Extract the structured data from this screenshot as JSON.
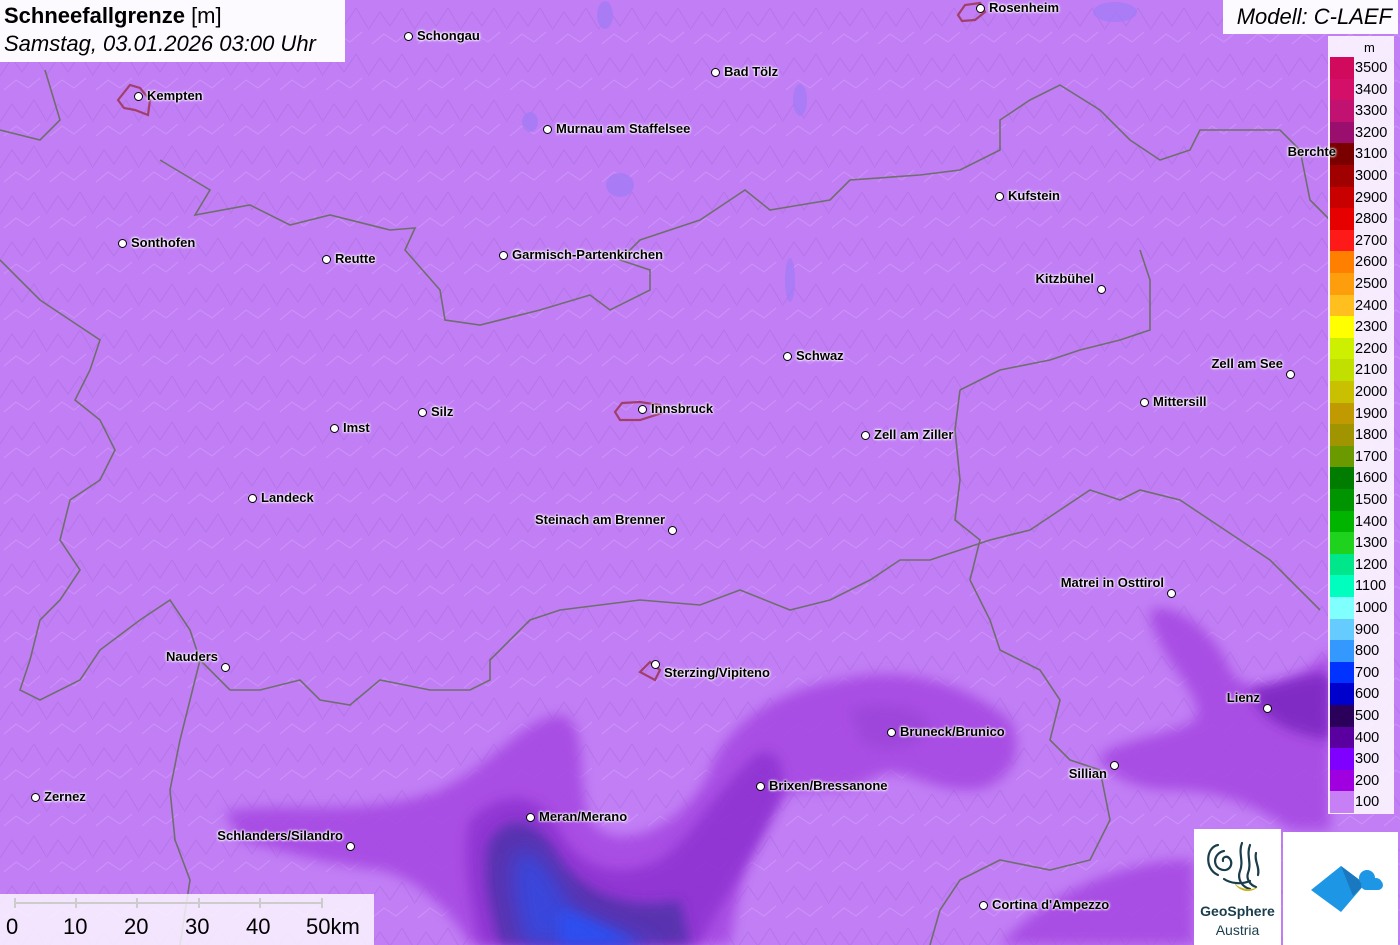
{
  "header": {
    "title_bold": "Schneefallgrenze",
    "title_unit": " [m]",
    "datetime": "Samstag, 03.01.2026 03:00 Uhr"
  },
  "model": {
    "label": "Modell: C-LAEF"
  },
  "legend": {
    "unit": "m",
    "items": [
      {
        "label": "3500",
        "color": "#d10a5e"
      },
      {
        "label": "3400",
        "color": "#d40f6a"
      },
      {
        "label": "3300",
        "color": "#c21271"
      },
      {
        "label": "3200",
        "color": "#9a0f6e"
      },
      {
        "label": "3100",
        "color": "#7a0000"
      },
      {
        "label": "3000",
        "color": "#a00000"
      },
      {
        "label": "2900",
        "color": "#c80000"
      },
      {
        "label": "2800",
        "color": "#e60000"
      },
      {
        "label": "2700",
        "color": "#ff1a1a"
      },
      {
        "label": "2600",
        "color": "#ff7f00"
      },
      {
        "label": "2500",
        "color": "#ff9e0d"
      },
      {
        "label": "2400",
        "color": "#ffbf1f"
      },
      {
        "label": "2300",
        "color": "#ffff00"
      },
      {
        "label": "2200",
        "color": "#ccf000"
      },
      {
        "label": "2100",
        "color": "#c2e000"
      },
      {
        "label": "2000",
        "color": "#c8c000"
      },
      {
        "label": "1900",
        "color": "#c09a00"
      },
      {
        "label": "1800",
        "color": "#a09500"
      },
      {
        "label": "1700",
        "color": "#6a9a00"
      },
      {
        "label": "1600",
        "color": "#007d00"
      },
      {
        "label": "1500",
        "color": "#009400"
      },
      {
        "label": "1400",
        "color": "#00b400"
      },
      {
        "label": "1300",
        "color": "#1ed21e"
      },
      {
        "label": "1200",
        "color": "#00e68a"
      },
      {
        "label": "1100",
        "color": "#00ffbf"
      },
      {
        "label": "1000",
        "color": "#80ffff"
      },
      {
        "label": "900",
        "color": "#66ccff"
      },
      {
        "label": "800",
        "color": "#3399ff"
      },
      {
        "label": "700",
        "color": "#0033ff"
      },
      {
        "label": "600",
        "color": "#0000cc"
      },
      {
        "label": "500",
        "color": "#2a005a"
      },
      {
        "label": "400",
        "color": "#5a00a0"
      },
      {
        "label": "300",
        "color": "#7f00ff"
      },
      {
        "label": "200",
        "color": "#a000e0"
      },
      {
        "label": "100",
        "color": "#c77ff5"
      }
    ]
  },
  "cities": [
    {
      "name": "Rosenheim"
    },
    {
      "name": "Schongau"
    },
    {
      "name": "Bad Tölz"
    },
    {
      "name": "Kempten"
    },
    {
      "name": "Murnau am Staffelsee"
    },
    {
      "name": "Berchte"
    },
    {
      "name": "Kufstein"
    },
    {
      "name": "Sonthofen"
    },
    {
      "name": "Reutte"
    },
    {
      "name": "Garmisch-Partenkirchen"
    },
    {
      "name": "Kitzbühel"
    },
    {
      "name": "Schwaz"
    },
    {
      "name": "Zell am See"
    },
    {
      "name": "Mittersill"
    },
    {
      "name": "Innsbruck"
    },
    {
      "name": "Silz"
    },
    {
      "name": "Imst"
    },
    {
      "name": "Zell am Ziller"
    },
    {
      "name": "Landeck"
    },
    {
      "name": "Steinach am Brenner"
    },
    {
      "name": "Matrei in Osttirol"
    },
    {
      "name": "Nauders"
    },
    {
      "name": "Sterzing/Vipiteno"
    },
    {
      "name": "Lienz"
    },
    {
      "name": "Bruneck/Brunico"
    },
    {
      "name": "Sillian"
    },
    {
      "name": "Brixen/Bressanone"
    },
    {
      "name": "Zernez"
    },
    {
      "name": "Meran/Merano"
    },
    {
      "name": "Schlanders/Silandro"
    },
    {
      "name": "Cortina d'Ampezzo"
    }
  ],
  "scalebar": {
    "labels": [
      "0",
      "10",
      "20",
      "30",
      "40",
      "50km"
    ]
  },
  "logos": {
    "geosphere_name": "GeoSphere",
    "geosphere_sub": "Austria"
  },
  "colors": {
    "base_field": "#c27ff5",
    "border": "#6e6e6e",
    "city_outline": "#a0406a"
  }
}
